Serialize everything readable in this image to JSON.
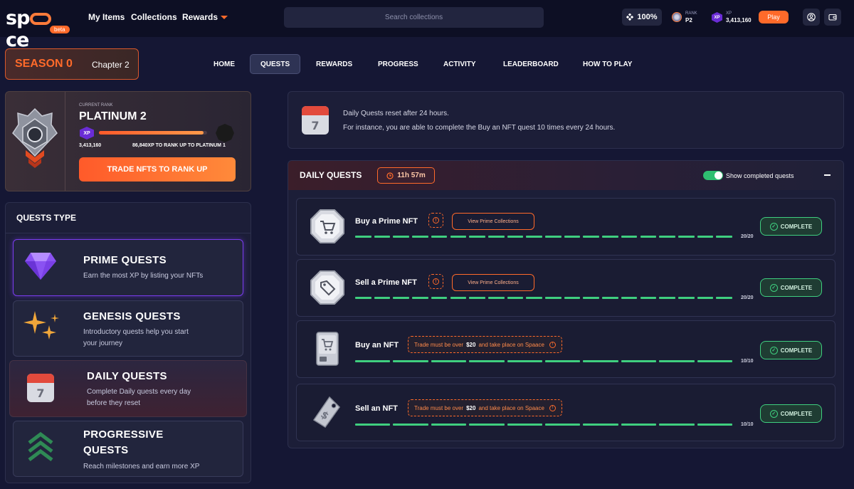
{
  "topbar": {
    "logo": "spaace",
    "beta": "beta",
    "nav": [
      "My Items",
      "Collections",
      "Rewards"
    ],
    "search_placeholder": "Search collections",
    "percent": "100%",
    "rank_caption": "RANK",
    "rank_value": "P2",
    "xp_caption": "XP",
    "xp_value": "3,413,160",
    "play_label": "Play"
  },
  "season": {
    "title": "SEASON 0",
    "chapter": "Chapter 2"
  },
  "tabs": [
    "HOME",
    "QUESTS",
    "REWARDS",
    "PROGRESS",
    "ACTIVITY",
    "LEADERBOARD",
    "HOW TO PLAY"
  ],
  "active_tab": "QUESTS",
  "rank_card": {
    "caption": "CURRENT RANK",
    "rank": "PLATINUM 2",
    "xp_badge": "XP",
    "xp_total": "3,413,160",
    "xp_to_next": "86,840XP TO RANK UP TO PLATINUM 1",
    "progress_fraction": 0.97,
    "cta": "TRADE NFTS TO RANK UP"
  },
  "quests_type": {
    "header": "QUESTS TYPE",
    "items": [
      {
        "title": "PRIME QUESTS",
        "desc": "Earn the most XP by listing your NFTs"
      },
      {
        "title": "GENESIS QUESTS",
        "desc1": "Introductory quests help you start",
        "desc2": "your journey"
      },
      {
        "title": "DAILY QUESTS",
        "desc1": "Complete Daily quests every day",
        "desc2": "before they reset"
      },
      {
        "title1": "PROGRESSIVE",
        "title2": "QUESTS",
        "desc": "Reach milestones and earn more XP"
      }
    ]
  },
  "info": {
    "calendar_day": "7",
    "line1": "Daily Quests reset after 24 hours.",
    "line2": "For instance, you are able to complete the Buy an NFT quest 10 times every 24 hours."
  },
  "daily": {
    "title": "DAILY QUESTS",
    "timer": "11h 57m",
    "toggle_label": "Show completed quests",
    "quests": [
      {
        "name": "Buy a Prime NFT",
        "button": "View Prime Collections",
        "count": "20/20",
        "segments": 20,
        "status": "COMPLETE"
      },
      {
        "name": "Sell a Prime NFT",
        "button": "View Prime Collections",
        "count": "20/20",
        "segments": 20,
        "status": "COMPLETE"
      },
      {
        "name": "Buy an NFT",
        "note_pre": "Trade must be over ",
        "note_amount": "$20",
        "note_post": " and take place on Spaace",
        "count": "10/10",
        "segments": 10,
        "status": "COMPLETE"
      },
      {
        "name": "Sell an NFT",
        "note_pre": "Trade must be over ",
        "note_amount": "$20",
        "note_post": " and take place on Spaace",
        "count": "10/10",
        "segments": 10,
        "status": "COMPLETE"
      }
    ]
  },
  "colors": {
    "accent": "#ff6a2a",
    "purple": "#6a2cd6",
    "success": "#3fcf7f",
    "bg": "#151734"
  }
}
